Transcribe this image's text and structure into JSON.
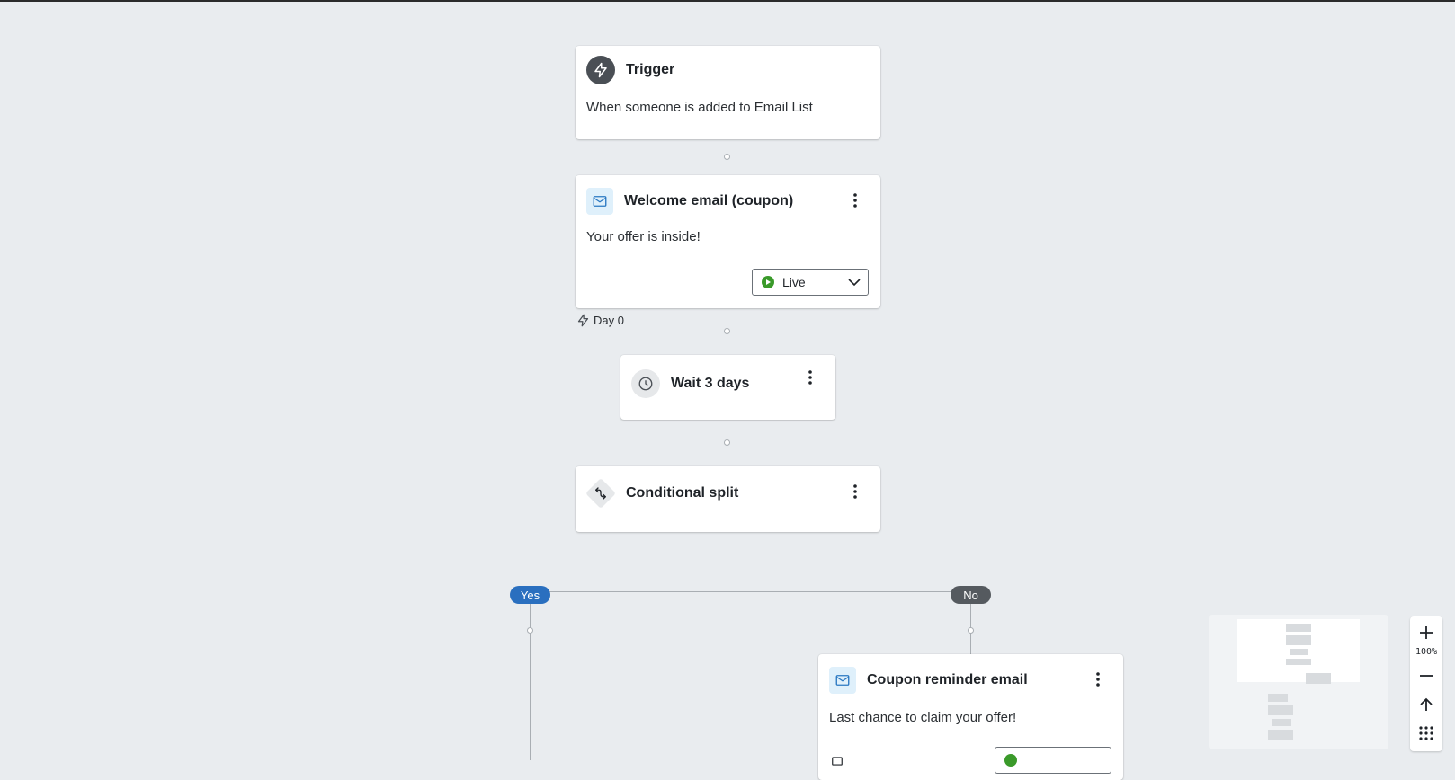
{
  "trigger": {
    "title": "Trigger",
    "description": "When someone is added to Email List",
    "icon": "lightning-icon"
  },
  "welcome_email": {
    "title": "Welcome email (coupon)",
    "subject": "Your offer is inside!",
    "status": "Live",
    "icon": "envelope-icon"
  },
  "day_label": "Day 0",
  "wait": {
    "title": "Wait 3 days",
    "icon": "clock-icon"
  },
  "split": {
    "title": "Conditional split",
    "icon": "split-arrows-icon"
  },
  "branches": {
    "yes": "Yes",
    "no": "No"
  },
  "reminder_email": {
    "title": "Coupon reminder email",
    "subject": "Last chance to claim your offer!",
    "icon": "envelope-icon"
  },
  "zoom": {
    "level": "100%"
  },
  "colors": {
    "yes_branch": "#2a6fbf",
    "no_branch": "#555a5f",
    "live_status": "#3a9a2a",
    "email_icon_bg": "#dff0fb",
    "email_icon": "#2a78c2"
  }
}
